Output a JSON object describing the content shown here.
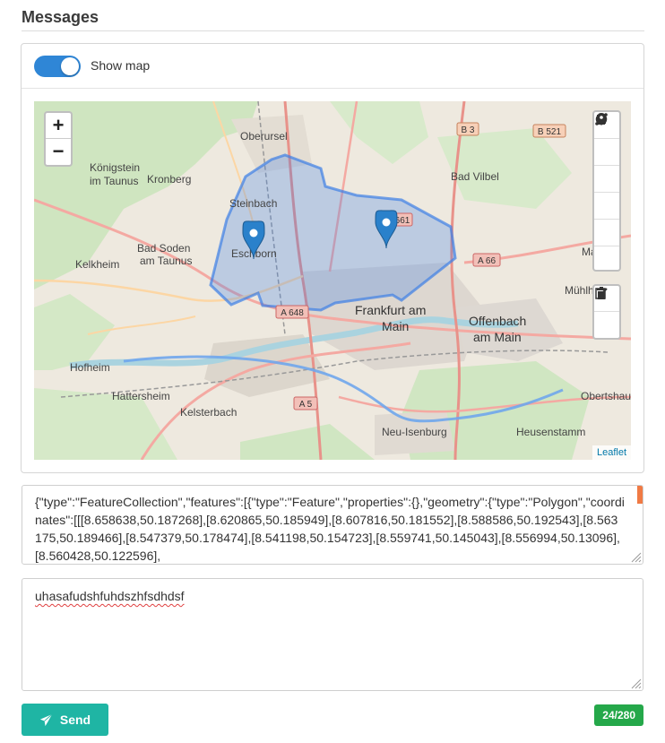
{
  "page": {
    "title": "Messages"
  },
  "map_toggle": {
    "label": "Show map",
    "on": true,
    "color": "#2f86d6"
  },
  "map": {
    "zoom_in": "+",
    "zoom_out": "−",
    "attribution": "Leaflet",
    "places": [
      "Oberursel",
      "Königstein",
      "im Taunus",
      "Kronberg",
      "Steinbach",
      "Eschborn",
      "Bad Soden",
      "am Taunus",
      "Kelkheim",
      "Bad Vilbel",
      "Frankfurt am",
      "Main",
      "Offenbach",
      "am Main",
      "Mühlh",
      "Hofheim",
      "Hattersheim",
      "Kelsterbach",
      "Neu-Isenburg",
      "Heusenstamm",
      "Obertshaus",
      "Ma"
    ],
    "road_shields": [
      "B 3",
      "B 521",
      "A 66",
      "A 648",
      "A 5",
      "661"
    ],
    "draw_tools": [
      "polyline-icon",
      "polygon-icon",
      "rectangle-icon",
      "circle-icon",
      "marker-icon",
      "circlemarker-icon"
    ],
    "edit_tools": [
      "edit-icon",
      "trash-icon"
    ],
    "polygon_color": "#3d7fe6"
  },
  "geojson_field": {
    "value": "{\"type\":\"FeatureCollection\",\"features\":[{\"type\":\"Feature\",\"properties\":{},\"geometry\":{\"type\":\"Polygon\",\"coordinates\":[[[8.658638,50.187268],[8.620865,50.185949],[8.607816,50.181552],[8.588586,50.192543],[8.563175,50.189466],[8.547379,50.178474],[8.541198,50.154723],[8.559741,50.145043],[8.556994,50.13096],[8.560428,50.122596],"
  },
  "message_field": {
    "value": "uhasafudshfuhdszhfsdhdsf"
  },
  "send_button": {
    "label": "Send",
    "color": "#1fb5a4"
  },
  "char_counter": {
    "text": "24/280",
    "color": "#25a84a"
  }
}
